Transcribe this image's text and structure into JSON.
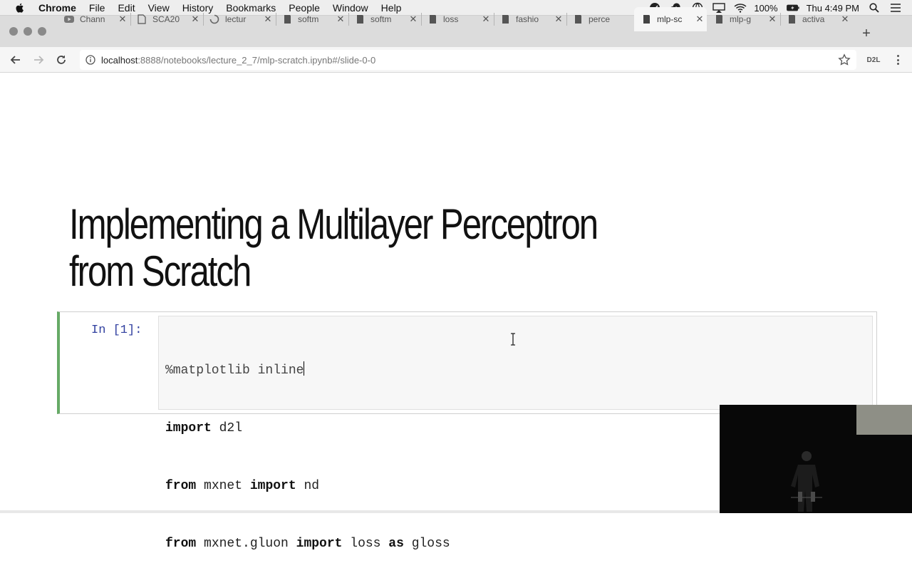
{
  "menubar": {
    "app_name": "Chrome",
    "items": [
      "File",
      "Edit",
      "View",
      "History",
      "Bookmarks",
      "People",
      "Window",
      "Help"
    ],
    "battery": "100%",
    "clock": "Thu 4:49 PM"
  },
  "tabs": [
    {
      "title": "Chann",
      "icon": "youtube-icon",
      "active": false
    },
    {
      "title": "SCA20",
      "icon": "document-icon",
      "active": false
    },
    {
      "title": "lectur",
      "icon": "loading-spinner-icon",
      "active": false
    },
    {
      "title": "softm",
      "icon": "notebook-icon",
      "active": false
    },
    {
      "title": "softm",
      "icon": "notebook-icon",
      "active": false
    },
    {
      "title": "loss",
      "icon": "notebook-icon",
      "active": false
    },
    {
      "title": "fashio",
      "icon": "notebook-icon",
      "active": false
    },
    {
      "title": "perce",
      "icon": "notebook-icon",
      "active": false
    },
    {
      "title": "mlp-sc",
      "icon": "notebook-icon",
      "active": true
    },
    {
      "title": "mlp-g",
      "icon": "notebook-icon",
      "active": false
    },
    {
      "title": "activa",
      "icon": "notebook-icon",
      "active": false
    }
  ],
  "toolbar": {
    "url_host": "localhost",
    "url_path": ":8888/notebooks/lecture_2_7/mlp-scratch.ipynb#/slide-0-0",
    "extension_label": "D2L"
  },
  "slide": {
    "title_line1": "Implementing a Multilayer Perceptron",
    "title_line2": "from Scratch"
  },
  "cell": {
    "prompt": "In [1]:",
    "line1": "%matplotlib inline",
    "line2_kw": "import",
    "line2_rest": " d2l",
    "line3_kw1": "from",
    "line3_mid": " mxnet ",
    "line3_kw2": "import",
    "line3_rest": " nd",
    "line4_kw1": "from",
    "line4_mid": " mxnet.gluon ",
    "line4_kw2": "import",
    "line4_mid2": " loss ",
    "line4_kw3": "as",
    "line4_rest": " gloss"
  },
  "colors": {
    "cell_border_selected": "#66aa66",
    "prompt": "#303f9f"
  }
}
